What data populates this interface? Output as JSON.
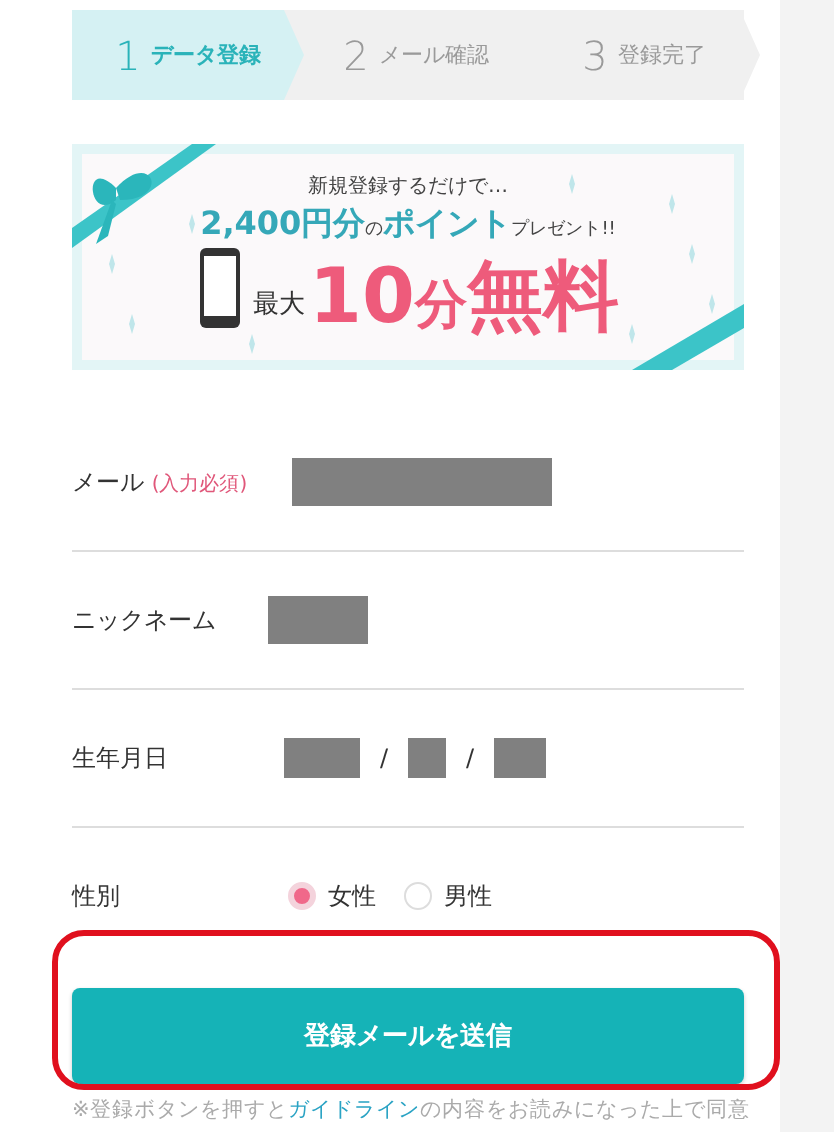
{
  "steps": [
    {
      "number": "1",
      "label": "データ登録",
      "selected": true
    },
    {
      "number": "2",
      "label": "メール確認",
      "selected": false
    },
    {
      "number": "3",
      "label": "登録完了",
      "selected": false
    }
  ],
  "banner": {
    "intro": "新規登録するだけで…",
    "headline": [
      {
        "text": "2,400円分",
        "kind": "big"
      },
      {
        "text": "の",
        "kind": "small"
      },
      {
        "text": "ポイント",
        "kind": "big"
      },
      {
        "text": "プレゼント!!",
        "kind": "small"
      }
    ],
    "prefix": "最大",
    "offer": [
      {
        "text": "10",
        "kind": "big"
      },
      {
        "text": "分",
        "kind": "mid"
      },
      {
        "text": "無料",
        "kind": "big"
      }
    ]
  },
  "form": [
    {
      "kind": "email",
      "label": "メール",
      "required_note": "(入力必須)"
    },
    {
      "kind": "nickname",
      "label": "ニックネーム"
    },
    {
      "kind": "date",
      "label": "生年月日",
      "separators": [
        "/",
        "/"
      ]
    },
    {
      "kind": "radio",
      "label": "性別",
      "options": [
        {
          "label": "女性",
          "selected": true
        },
        {
          "label": "男性",
          "selected": false
        }
      ]
    }
  ],
  "submit": {
    "label": "登録メールを送信",
    "highlighted": true
  },
  "notice": [
    {
      "text": "※登録ボタンを押すと",
      "kind": "plain"
    },
    {
      "text": "ガイドライン",
      "kind": "link"
    },
    {
      "text": "の内容をお読みになった上で同意",
      "kind": "plain"
    }
  ]
}
